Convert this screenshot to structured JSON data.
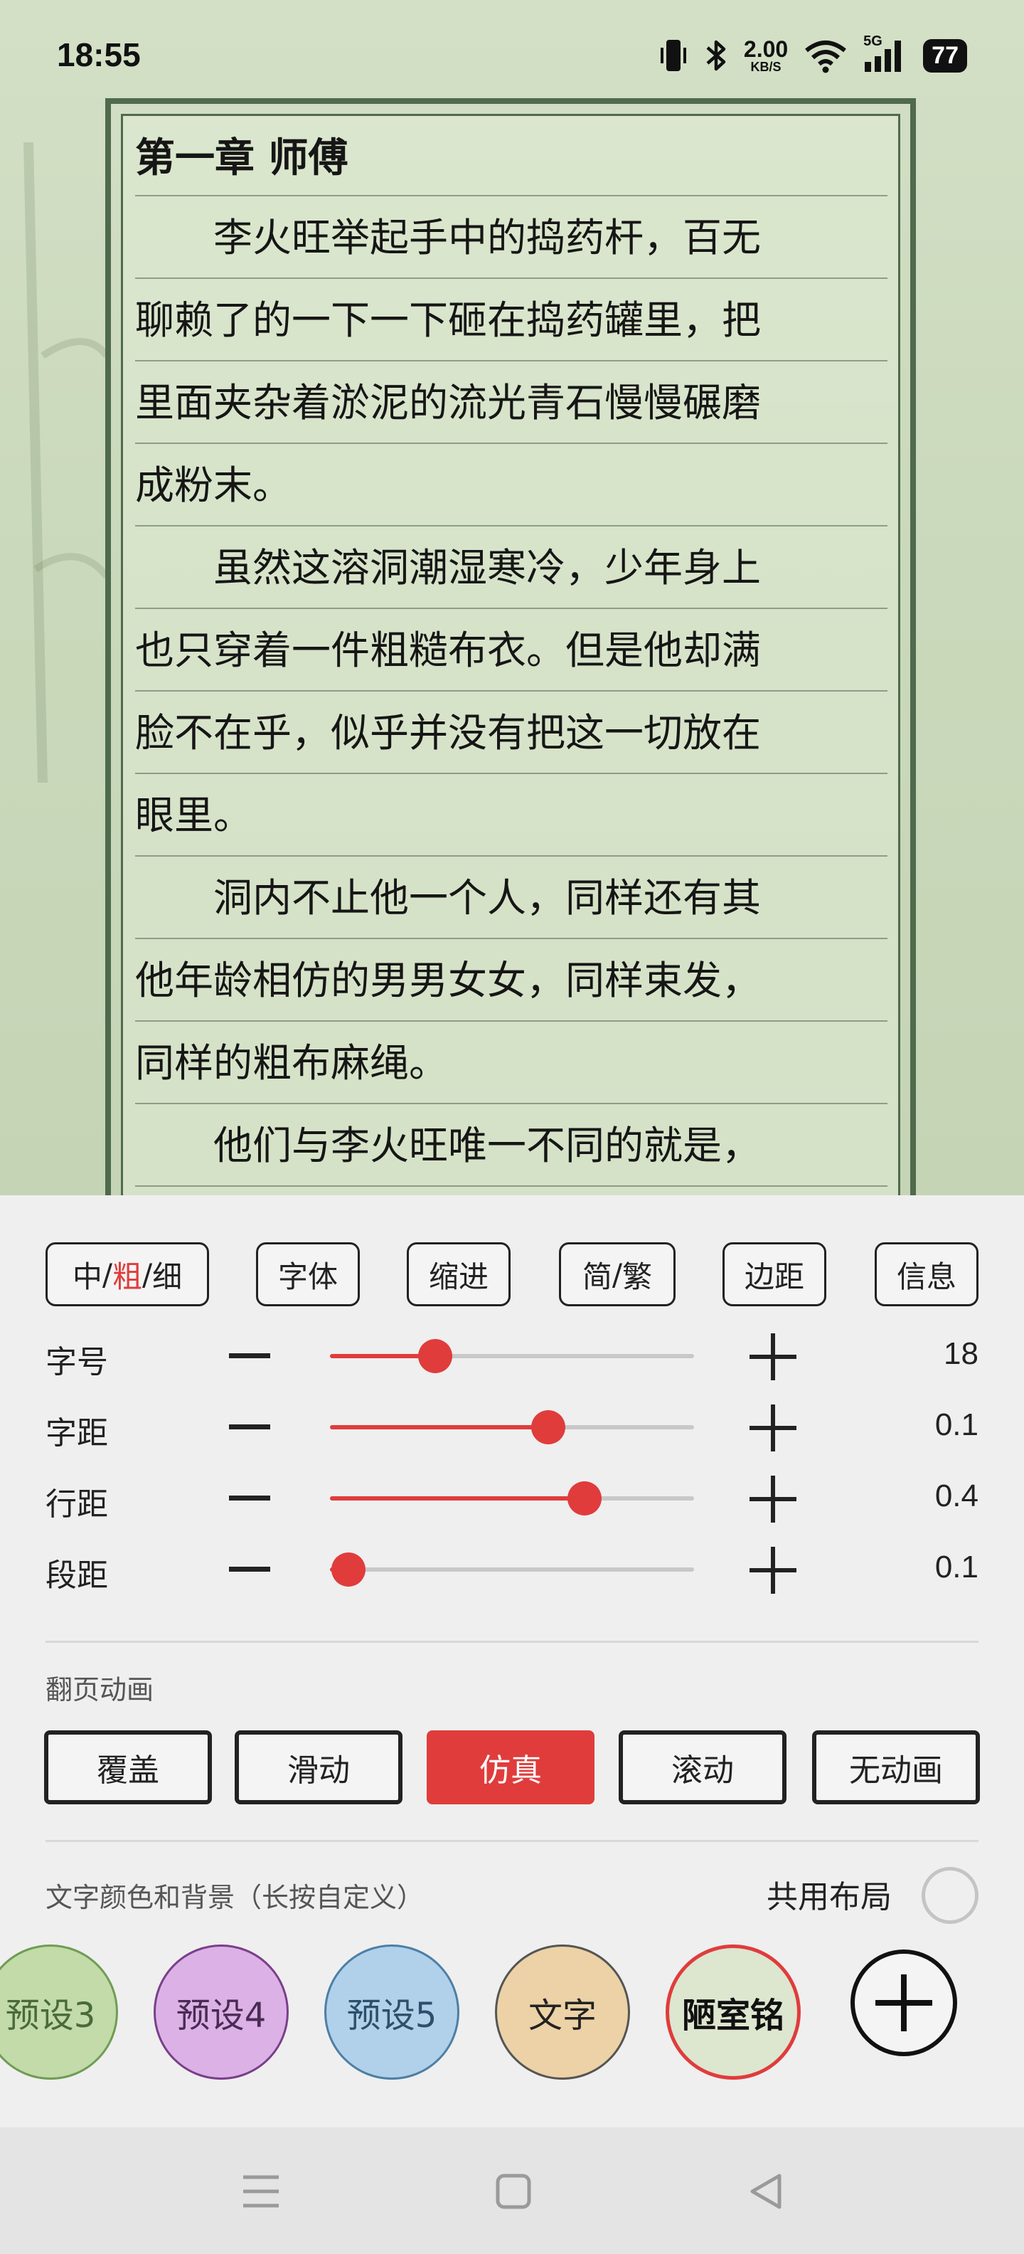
{
  "status_bar": {
    "time": "18:55",
    "net_speed_value": "2.00",
    "net_speed_unit": "KB/S",
    "signal_label": "5G",
    "battery": "77",
    "icons": [
      "vibrate-icon",
      "bluetooth-icon",
      "wifi-icon",
      "cellular-signal-icon",
      "battery-icon"
    ]
  },
  "reader": {
    "lines": [
      "第一章 师傅",
      "　　李火旺举起手中的捣药杆，百无",
      "聊赖了的一下一下砸在捣药罐里，把",
      "里面夹杂着淤泥的流光青石慢慢碾磨",
      "成粉末。",
      "　　虽然这溶洞潮湿寒冷，少年身上",
      "也只穿着一件粗糙布衣。但是他却满",
      "脸不在乎，似乎并没有把这一切放在",
      "眼里。",
      "　　洞内不止他一个人，同样还有其",
      "他年龄相仿的男男女女，同样束发，",
      "同样的粗布麻绳。",
      "　　他们与李火旺唯一不同的就是，"
    ]
  },
  "settings": {
    "top_buttons": {
      "weight_mid": "中",
      "weight_bold": "粗",
      "weight_thin": "细",
      "sep": "/",
      "font": "字体",
      "indent": "缩进",
      "simp": "简",
      "trad": "繁",
      "margin": "边距",
      "info": "信息"
    },
    "sliders": [
      {
        "label": "字号",
        "value": "18",
        "level": 0.29
      },
      {
        "label": "字距",
        "value": "0.1",
        "level": 0.6
      },
      {
        "label": "行距",
        "value": "0.4",
        "level": 0.7
      },
      {
        "label": "段距",
        "value": "0.1",
        "level": 0.05
      }
    ],
    "page_anim_label": "翻页动画",
    "page_anims": [
      "覆盖",
      "滑动",
      "仿真",
      "滚动",
      "无动画"
    ],
    "active_page_anim": "仿真",
    "color_label": "文字颜色和背景（长按自定义）",
    "shared_layout_label": "共用布局",
    "shared_layout_checked": false,
    "color_presets": [
      "预设3",
      "预设4",
      "预设5",
      "文字",
      "陋室铭"
    ],
    "colors": {
      "accent": "#e03c3c",
      "preset3": "#c2dba8",
      "preset4": "#dcb2e6",
      "preset5": "#b1d1ea",
      "text_preset": "#ecd2a6",
      "selected_preset": "#dde6cf"
    }
  },
  "navbar": {
    "icons": [
      "menu-icon",
      "home-square-icon",
      "back-triangle-icon"
    ]
  }
}
